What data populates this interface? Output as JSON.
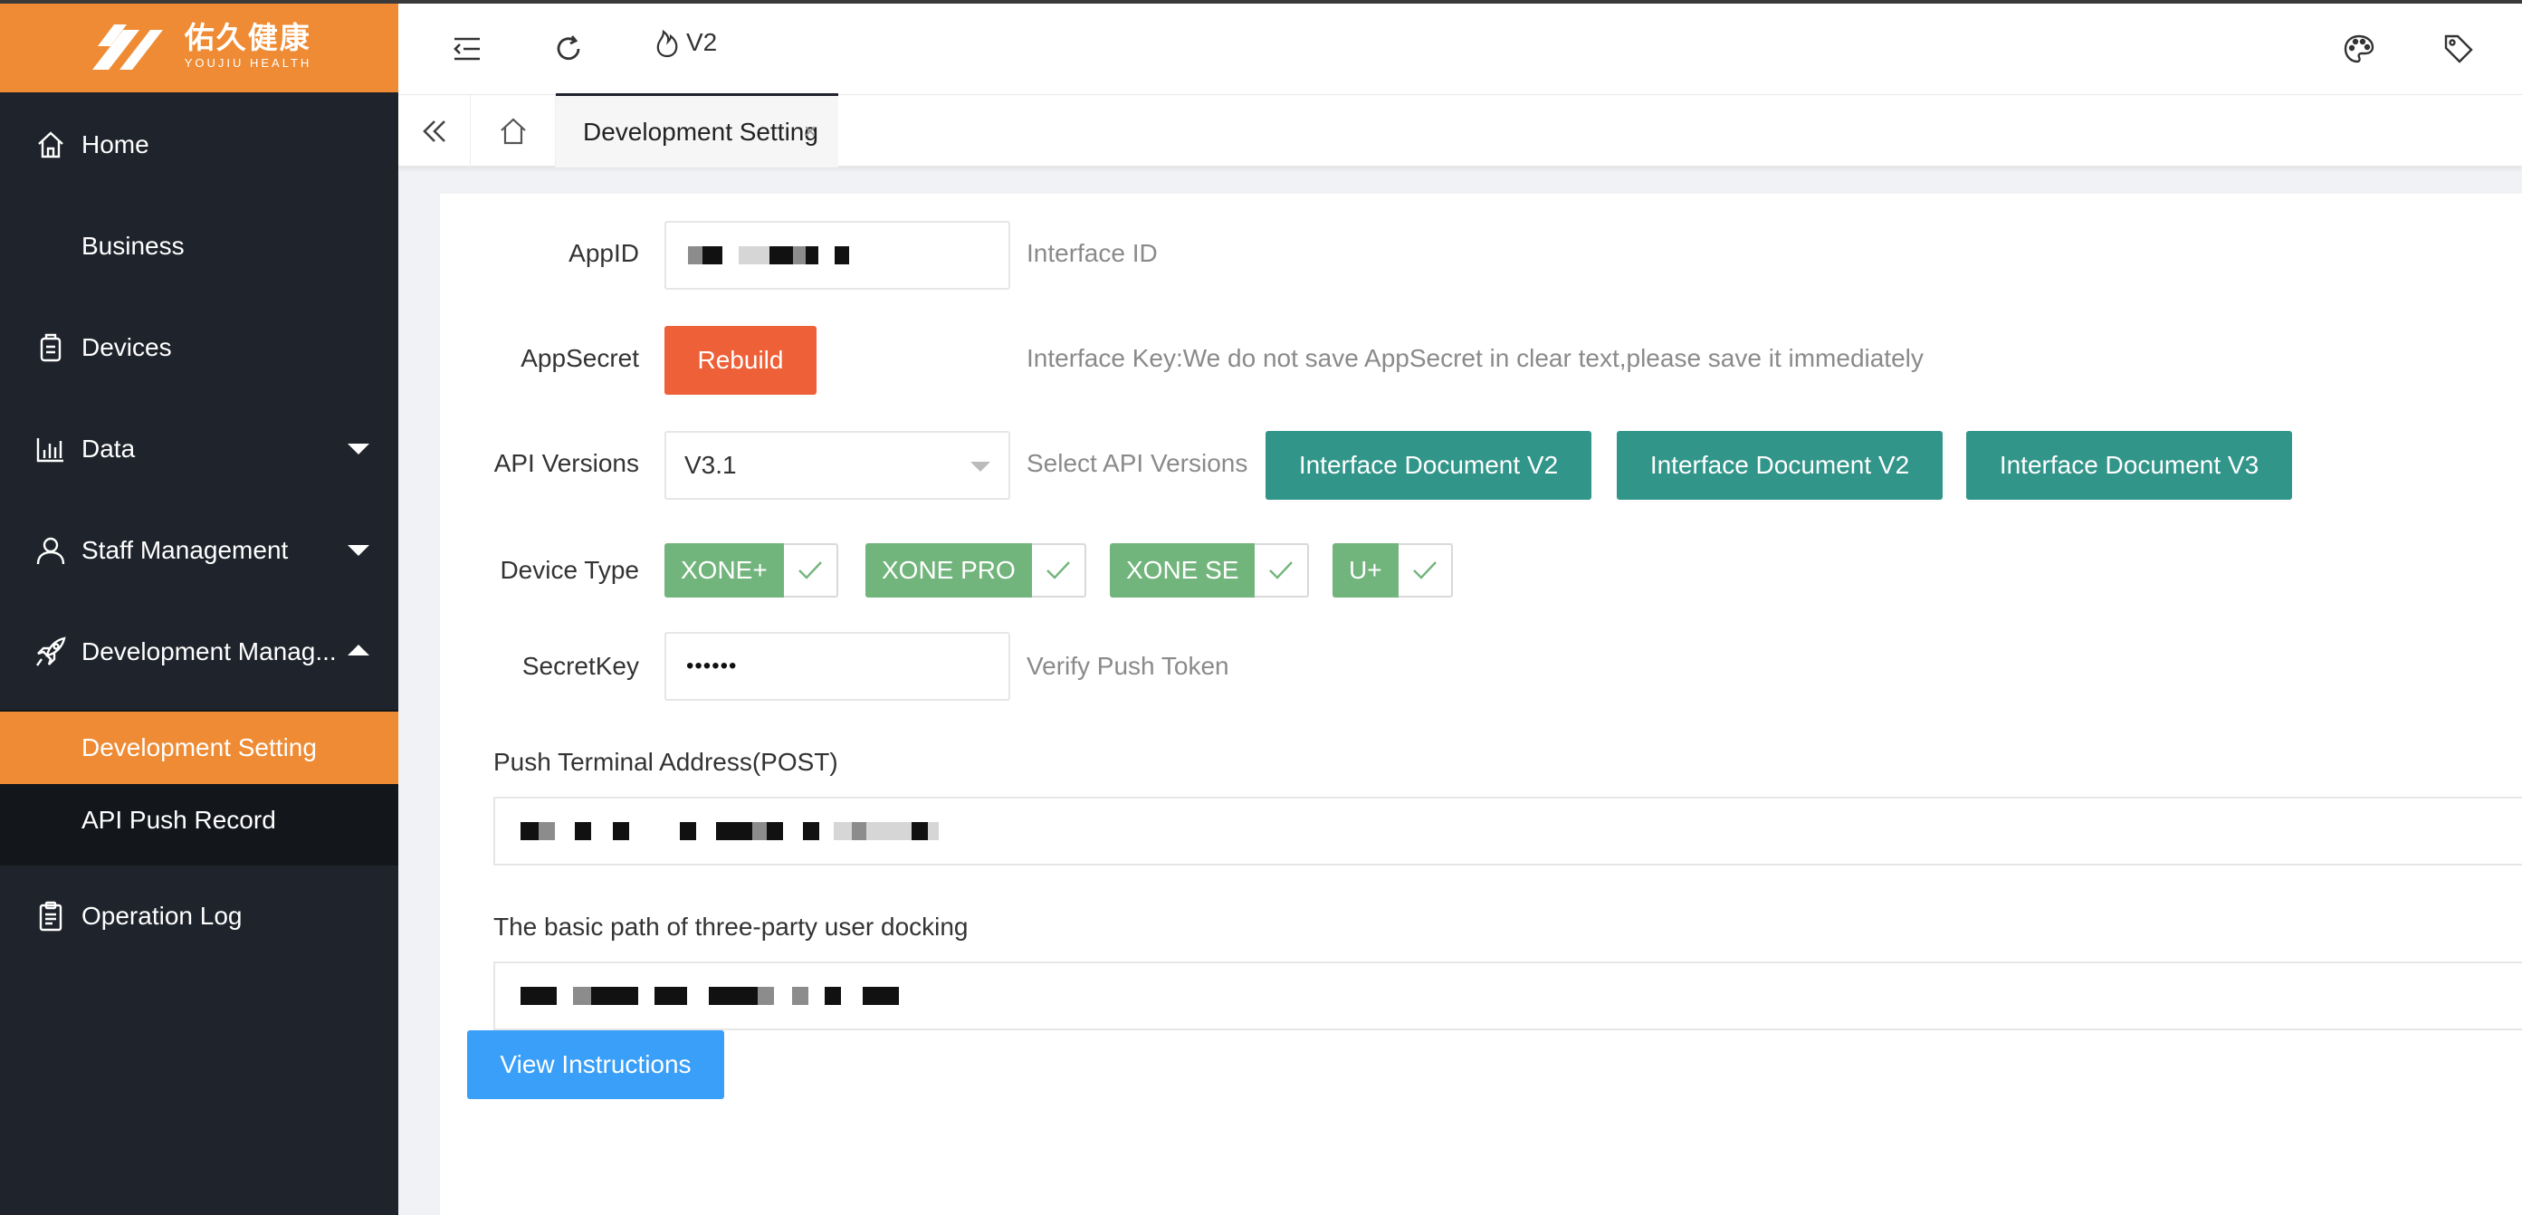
{
  "brand": {
    "name_cn": "佑久健康",
    "name_en": "YOUJIU HEALTH",
    "color": "#ee8b34"
  },
  "sidebar": {
    "items": [
      {
        "label": "Home",
        "icon": "home-icon"
      },
      {
        "label": "Business"
      },
      {
        "label": "Devices",
        "icon": "devices-icon"
      },
      {
        "label": "Data",
        "icon": "bar-chart-icon",
        "expanded": false
      },
      {
        "label": "Staff Management",
        "icon": "user-icon",
        "expanded": false
      },
      {
        "label": "Development Manag...",
        "icon": "rocket-icon",
        "expanded": true
      },
      {
        "label": "Operation Log",
        "icon": "clipboard-icon"
      }
    ],
    "subitems": [
      {
        "label": "Development Setting",
        "active": true
      },
      {
        "label": "API Push Record"
      }
    ]
  },
  "header": {
    "version_label": "V2",
    "icons": [
      "menu-fold-icon",
      "refresh-icon",
      "flame-icon",
      "palette-icon",
      "tag-icon"
    ]
  },
  "tabs": {
    "active_label": "Development Setting",
    "close_glyph": "×"
  },
  "form": {
    "appid": {
      "label": "AppID",
      "hint": "Interface ID"
    },
    "appsecret": {
      "label": "AppSecret",
      "button": "Rebuild",
      "hint": "Interface Key:We do not save AppSecret in clear text,please save it immediately"
    },
    "api_versions": {
      "label": "API Versions",
      "value": "V3.1",
      "hint": "Select API Versions",
      "doc_buttons": [
        "Interface Document V2",
        "Interface Document V2",
        "Interface Document V3"
      ]
    },
    "device_type": {
      "label": "Device Type",
      "options": [
        {
          "label": "XONE+",
          "checked": true
        },
        {
          "label": "XONE PRO",
          "checked": true
        },
        {
          "label": "XONE SE",
          "checked": true
        },
        {
          "label": "U+",
          "checked": true
        }
      ]
    },
    "secretkey": {
      "label": "SecretKey",
      "value": "••••••",
      "hint": "Verify Push Token"
    },
    "push_address": {
      "label": "Push Terminal Address(POST)"
    },
    "basic_path": {
      "label": "The basic path of three-party user docking"
    },
    "instructions_button": "View Instructions"
  },
  "colors": {
    "sidebar_bg": "#1f232b",
    "accent_orange": "#ee8b34",
    "rebuild_red": "#ee6037",
    "doc_teal": "#32958a",
    "check_green": "#72b57c",
    "primary_blue": "#3a9ff8"
  }
}
